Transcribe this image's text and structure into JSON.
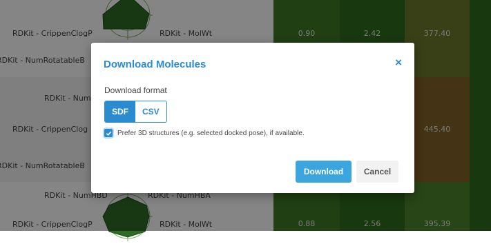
{
  "background": {
    "row1": {
      "labels": {
        "left": "RDKit - CrippenClogP",
        "right": "RDKit - MolWt",
        "bottom_left": "RDKit - NumRotatableB"
      },
      "values": [
        "0.90",
        "2.42",
        "377.40"
      ]
    },
    "row2": {
      "labels": {
        "top": "RDKit - Num",
        "left": "RDKit - CrippenClog",
        "bottom_left": "RDKit - NumRotatableB"
      },
      "values": [
        "445.40"
      ]
    },
    "row3": {
      "labels": {
        "top_left": "RDKit - NumHBD",
        "top_right": "RDKit - NumHBA",
        "left": "RDKit - CrippenClogP",
        "right": "RDKit - MolWt"
      },
      "values": [
        "0.88",
        "2.56",
        "395.39"
      ]
    },
    "colors": {
      "green_dark": "#2f6b1d",
      "green_mid": "#3f7a24",
      "green_light": "#4b842c",
      "olive": "#6e7a2c",
      "brown": "#85632a"
    }
  },
  "modal": {
    "title": "Download Molecules",
    "close": "×",
    "format_label": "Download format",
    "formats": [
      "SDF",
      "CSV"
    ],
    "selected_format": "SDF",
    "checkbox": {
      "checked": true,
      "label": "Prefer 3D structures (e.g. selected docked pose), if available."
    },
    "buttons": {
      "download": "Download",
      "cancel": "Cancel"
    },
    "accent": "#2a8bd0"
  }
}
